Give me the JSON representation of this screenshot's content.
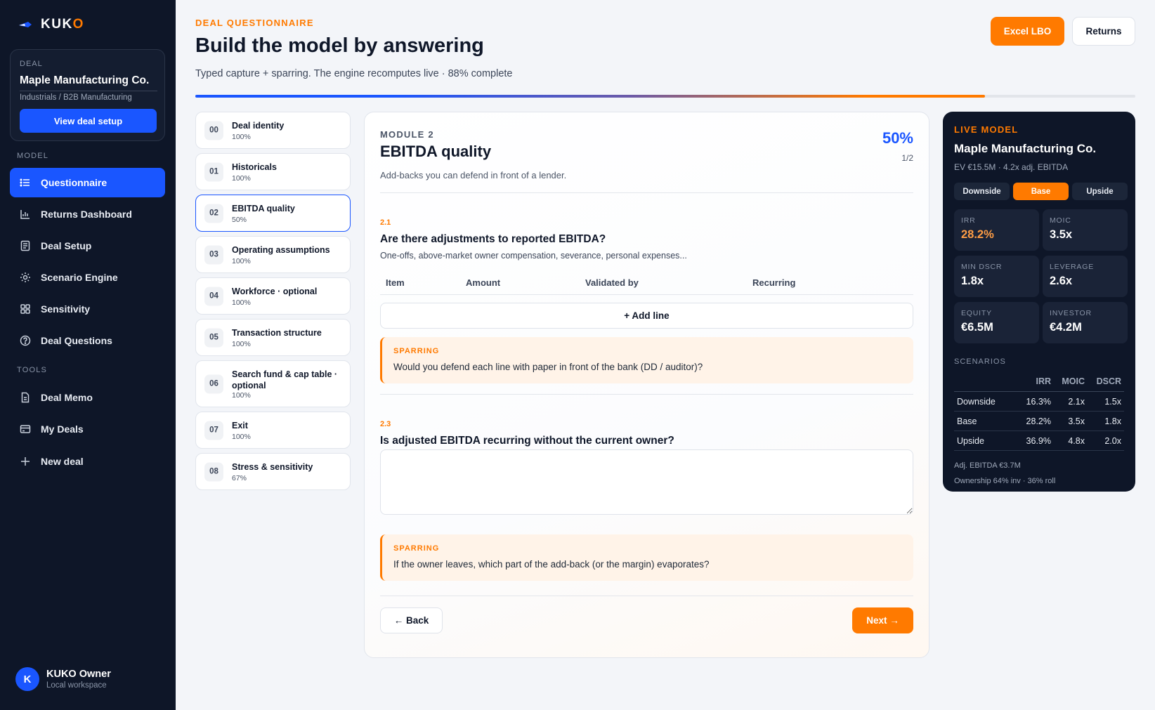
{
  "brand": {
    "name_part1": "KUK",
    "name_part2": "O"
  },
  "sidebar": {
    "deal_label": "DEAL",
    "deal_name": "Maple Manufacturing Co.",
    "deal_sector": "Industrials / B2B Manufacturing",
    "view_setup": "View deal setup",
    "model_label": "MODEL",
    "tools_label": "TOOLS",
    "nav": [
      {
        "label": "Questionnaire",
        "icon": "list-icon",
        "active": true
      },
      {
        "label": "Returns Dashboard",
        "icon": "bar-chart-icon"
      },
      {
        "label": "Deal Setup",
        "icon": "document-icon"
      },
      {
        "label": "Scenario Engine",
        "icon": "sun-icon"
      },
      {
        "label": "Sensitivity",
        "icon": "grid-icon"
      },
      {
        "label": "Deal Questions",
        "icon": "help-circle-icon"
      }
    ],
    "tools": [
      {
        "label": "Deal Memo",
        "icon": "file-icon"
      },
      {
        "label": "My Deals",
        "icon": "card-icon"
      },
      {
        "label": "New deal",
        "icon": "plus-icon"
      }
    ],
    "user": {
      "initial": "K",
      "name": "KUKO Owner",
      "workspace": "Local workspace"
    }
  },
  "header": {
    "eyebrow": "DEAL QUESTIONNAIRE",
    "title": "Build the model by answering",
    "subtitle": "Typed capture + sparring. The engine recomputes live · 88% complete",
    "progress": 0.84,
    "excel_btn": "Excel LBO",
    "returns_btn": "Returns"
  },
  "modules": [
    {
      "num": "00",
      "title": "Deal identity",
      "pct": "100%"
    },
    {
      "num": "01",
      "title": "Historicals",
      "pct": "100%"
    },
    {
      "num": "02",
      "title": "EBITDA quality",
      "pct": "50%",
      "active": true
    },
    {
      "num": "03",
      "title": "Operating assumptions",
      "pct": "100%"
    },
    {
      "num": "04",
      "title": "Workforce · optional",
      "pct": "100%"
    },
    {
      "num": "05",
      "title": "Transaction structure",
      "pct": "100%"
    },
    {
      "num": "06",
      "title": "Search fund & cap table · optional",
      "pct": "100%"
    },
    {
      "num": "07",
      "title": "Exit",
      "pct": "100%"
    },
    {
      "num": "08",
      "title": "Stress & sensitivity",
      "pct": "67%"
    }
  ],
  "module": {
    "label": "MODULE 2",
    "title": "EBITDA quality",
    "desc": "Add-backs you can defend in front of a lender.",
    "pct": "50%",
    "page": "1/2",
    "q1": {
      "num": "2.1",
      "title": "Are there adjustments to reported EBITDA?",
      "desc": "One-offs, above-market owner compensation, severance, personal expenses...",
      "columns": [
        "Item",
        "Amount",
        "Validated by",
        "Recurring"
      ],
      "add_line": "+ Add line",
      "spar_label": "SPARRING",
      "spar_text": "Would you defend each line with paper in front of the bank (DD / auditor)?"
    },
    "q2": {
      "num": "2.3",
      "title": "Is adjusted EBITDA recurring without the current owner?",
      "answer": "",
      "spar_label": "SPARRING",
      "spar_text": "If the owner leaves, which part of the add-back (or the margin) evaporates?"
    },
    "back": "← Back",
    "next": "Next →"
  },
  "live": {
    "label": "LIVE MODEL",
    "name": "Maple Manufacturing Co.",
    "ev": "EV €15.5M · 4.2x adj. EBITDA",
    "segments": [
      "Downside",
      "Base",
      "Upside"
    ],
    "active_segment": "Base",
    "kpis": [
      {
        "label": "IRR",
        "value": "28.2%"
      },
      {
        "label": "MOIC",
        "value": "3.5x"
      },
      {
        "label": "MIN DSCR",
        "value": "1.8x"
      },
      {
        "label": "LEVERAGE",
        "value": "2.6x"
      },
      {
        "label": "EQUITY",
        "value": "€6.5M"
      },
      {
        "label": "INVESTOR",
        "value": "€4.2M"
      }
    ],
    "scenarios_label": "SCENARIOS",
    "scenario_cols": [
      "IRR",
      "MOIC",
      "DSCR"
    ],
    "scenarios": [
      {
        "name": "Downside",
        "irr": "16.3%",
        "moic": "2.1x",
        "dscr": "1.5x"
      },
      {
        "name": "Base",
        "irr": "28.2%",
        "moic": "3.5x",
        "dscr": "1.8x"
      },
      {
        "name": "Upside",
        "irr": "36.9%",
        "moic": "4.8x",
        "dscr": "2.0x"
      }
    ],
    "adj_ebitda": "Adj. EBITDA €3.7M",
    "ownership": "Ownership 64% inv · 36% roll"
  },
  "colors": {
    "accent": "#1a56ff",
    "orange": "#ff7a00",
    "sidebar": "#0e1628"
  }
}
